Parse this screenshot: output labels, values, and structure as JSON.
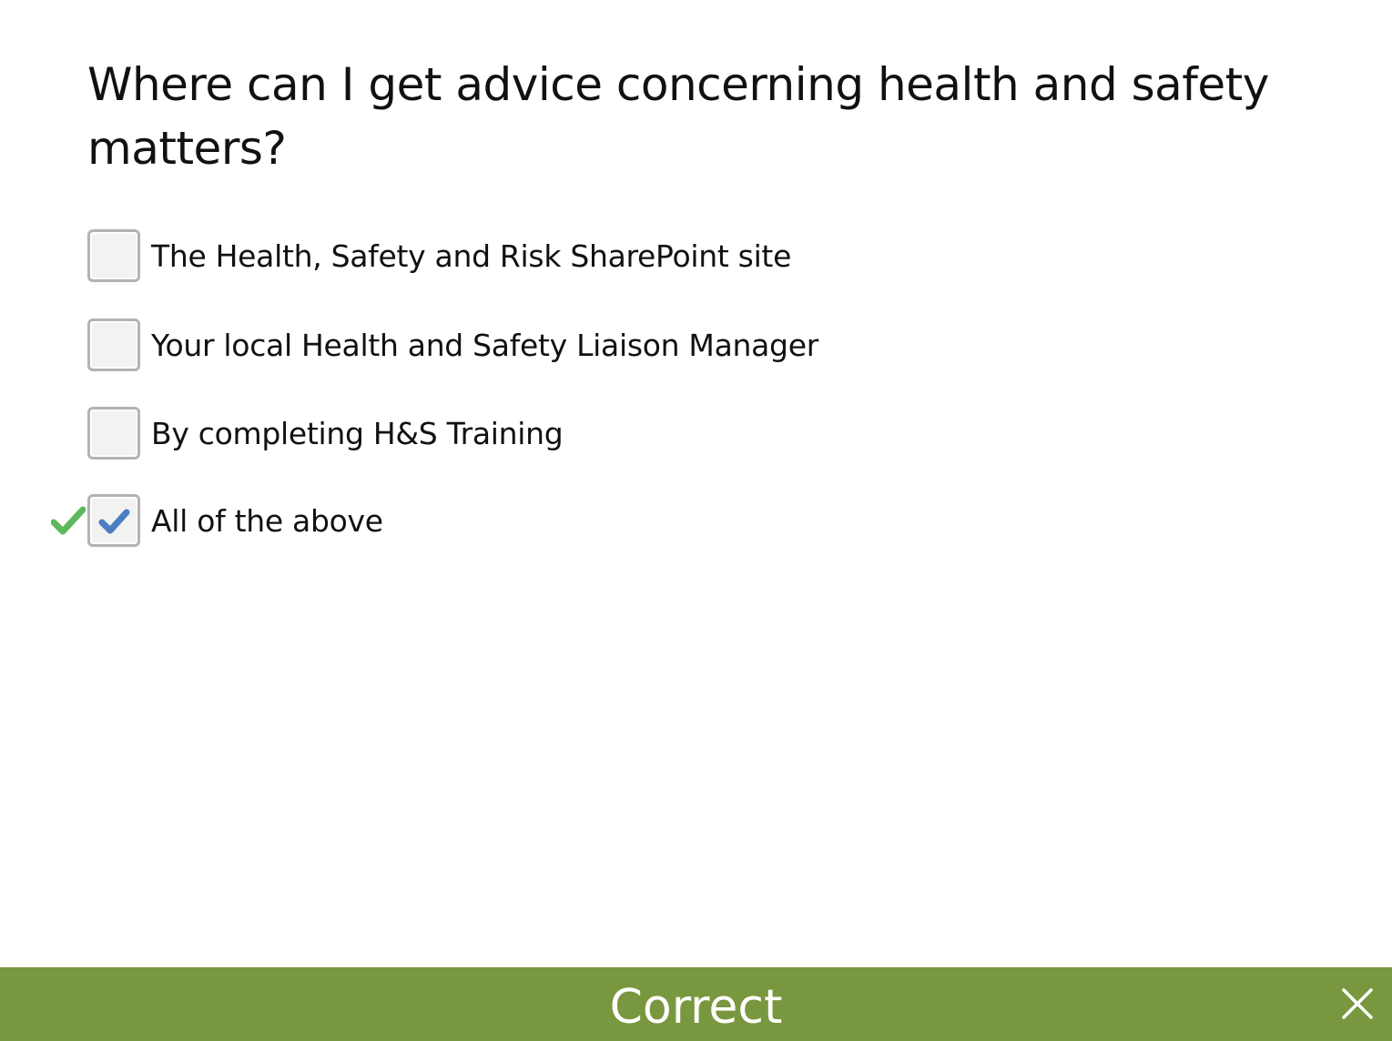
{
  "question": {
    "text": "Where can I get advice concerning health and safety matters?"
  },
  "options": [
    {
      "label": "The Health, Safety and Risk SharePoint site",
      "selected": false,
      "correct": false
    },
    {
      "label": "Your local Health and Safety Liaison Manager",
      "selected": false,
      "correct": false
    },
    {
      "label": "By completing H&S Training",
      "selected": false,
      "correct": false
    },
    {
      "label": "All of the above",
      "selected": true,
      "correct": true
    }
  ],
  "feedback": {
    "text": "Correct",
    "close_icon": "close-icon"
  },
  "colors": {
    "feedback_bar": "#79973e",
    "checkmark_blue": "#4a7ec0",
    "correct_green": "#5cb85c",
    "checkbox_border": "#b3b3b3"
  }
}
